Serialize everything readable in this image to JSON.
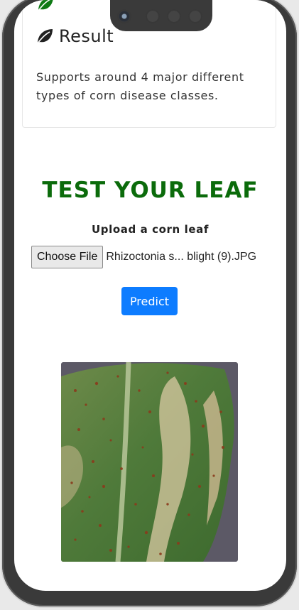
{
  "result_card": {
    "title": "Result",
    "description": "Supports around 4 major different types of corn disease classes."
  },
  "test_section": {
    "heading": "TEST YOUR LEAF",
    "upload_label": "Upload a corn leaf",
    "choose_file_label": "Choose File",
    "selected_file_name": "Rhizoctonia s... blight (9).JPG",
    "predict_label": "Predict"
  },
  "icons": {
    "leaf": "leaf-icon",
    "camera": "front-camera-icon"
  },
  "colors": {
    "heading_green": "#0b6b0b",
    "button_blue": "#0d7cff",
    "leaf_icon": "#222222",
    "top_leaf_icon": "#0e7a14"
  }
}
